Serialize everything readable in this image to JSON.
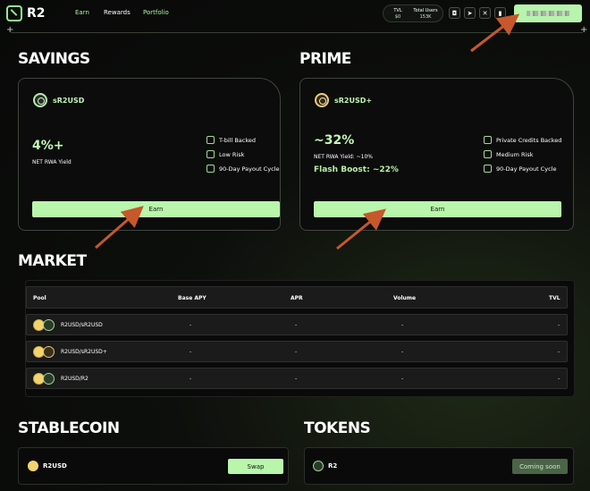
{
  "nav": {
    "brand": "R2",
    "links": [
      {
        "label": "Earn",
        "active": true
      },
      {
        "label": "Rewards",
        "active": false
      },
      {
        "label": "Portfolio",
        "active": true
      }
    ],
    "stats": {
      "tvl_label": "TVL",
      "tvl_value": "$0",
      "users_label": "Total Users",
      "users_value": "153K"
    },
    "icon_buttons": [
      "camera-icon",
      "telegram-icon",
      "x-icon",
      "bell-icon"
    ]
  },
  "savings": {
    "section_title": "SAVINGS",
    "token": "sR2USD",
    "yield": "4%+",
    "yield_label": "NET RWA Yield",
    "features": [
      "T-bill Backed",
      "Low Risk",
      "90-Day Payout Cycle"
    ],
    "button": "Earn"
  },
  "prime": {
    "section_title": "PRIME",
    "token": "sR2USD+",
    "yield": "~32%",
    "yield_label": "NET RWA Yield: ~10%",
    "flash": "Flash Boost: ~22%",
    "features": [
      "Private Credits Backed",
      "Medium Risk",
      "90-Day Payout Cycle"
    ],
    "button": "Earn"
  },
  "market": {
    "section_title": "MARKET",
    "headers": {
      "pool": "Pool",
      "apy": "Base APY",
      "apr": "APR",
      "volume": "Volume",
      "tvl": "TVL"
    },
    "rows": [
      {
        "pool": "R2USD/sR2USD",
        "apy": "-",
        "apr": "-",
        "volume": "-",
        "tvl": "-"
      },
      {
        "pool": "R2USD/sR2USD+",
        "apy": "-",
        "apr": "-",
        "volume": "-",
        "tvl": "-"
      },
      {
        "pool": "R2USD/R2",
        "apy": "-",
        "apr": "-",
        "volume": "-",
        "tvl": "-"
      }
    ]
  },
  "stablecoin": {
    "section_title": "STABLECOIN",
    "token": "R2USD",
    "button": "Swap"
  },
  "tokens": {
    "section_title": "TOKENS",
    "token": "R2",
    "button": "Coming soon"
  },
  "colors": {
    "accent": "#b9f5ab",
    "annotation_arrow": "#c6582b"
  }
}
